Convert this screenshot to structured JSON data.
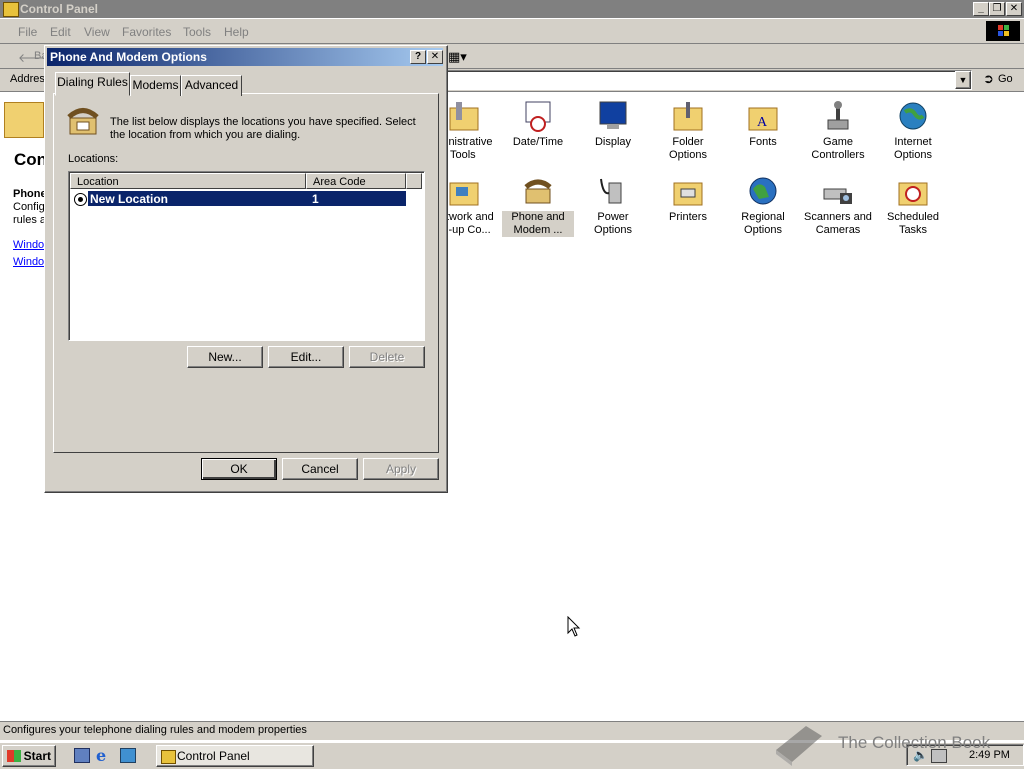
{
  "window": {
    "title": "Control Panel"
  },
  "menu": [
    "File",
    "Edit",
    "View",
    "Favorites",
    "Tools",
    "Help"
  ],
  "toolbar": {
    "back": "Ba"
  },
  "address": {
    "label": "Addres",
    "go": "Go"
  },
  "left_panel": {
    "title": "Con",
    "item_name": "Phone",
    "desc_lines": [
      "Config",
      "rules a"
    ],
    "links": [
      "Windo",
      "Windo"
    ]
  },
  "icons": [
    {
      "label1": "inistrative",
      "label2": "Tools"
    },
    {
      "label1": "Date/Time",
      "label2": ""
    },
    {
      "label1": "Display",
      "label2": ""
    },
    {
      "label1": "Folder Options",
      "label2": ""
    },
    {
      "label1": "Fonts",
      "label2": ""
    },
    {
      "label1": "Game",
      "label2": "Controllers"
    },
    {
      "label1": "Internet",
      "label2": "Options"
    },
    {
      "label1": "twork and",
      "label2": "l-up Co..."
    },
    {
      "label1": "Phone and",
      "label2": "Modem ..."
    },
    {
      "label1": "Power Options",
      "label2": ""
    },
    {
      "label1": "Printers",
      "label2": ""
    },
    {
      "label1": "Regional",
      "label2": "Options"
    },
    {
      "label1": "Scanners and",
      "label2": "Cameras"
    },
    {
      "label1": "Scheduled",
      "label2": "Tasks"
    }
  ],
  "dialog": {
    "title": "Phone And Modem Options",
    "help_glyph": "?",
    "close_glyph": "✕",
    "tabs": [
      "Dialing Rules",
      "Modems",
      "Advanced"
    ],
    "intro": "The list below displays the locations you have specified. Select the location from which you are dialing.",
    "locations_label": "Locations:",
    "columns": [
      "Location",
      "Area Code"
    ],
    "rows": [
      {
        "location": "New Location",
        "area_code": "1"
      }
    ],
    "buttons": {
      "new": "New...",
      "edit": "Edit...",
      "delete": "Delete"
    },
    "footer": {
      "ok": "OK",
      "cancel": "Cancel",
      "apply": "Apply"
    }
  },
  "statusbar": {
    "text": "Configures your telephone dialing rules and modem properties"
  },
  "taskbar": {
    "start": "Start",
    "task": "Control Panel",
    "clock": "2:49 PM"
  },
  "watermark": "The Collection Book"
}
